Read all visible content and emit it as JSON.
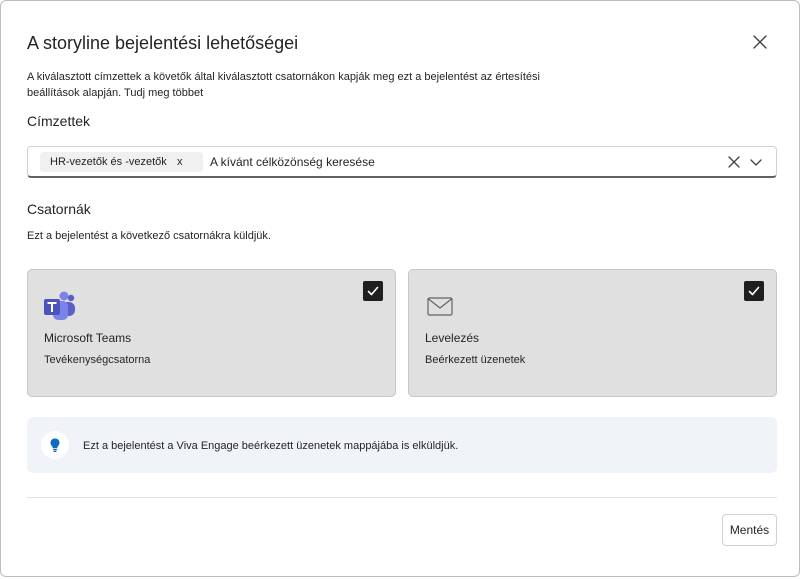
{
  "dialog": {
    "title": "A storyline bejelentési lehetőségei",
    "description": "A kiválasztott címzettek a követők által kiválasztott csatornákon kapják meg ezt a bejelentést az értesítési beállítások alapján.",
    "more_link": "Tudj meg többet"
  },
  "recipients": {
    "label": "Címzettek",
    "chip_label": "HR-vezetők és -vezetők",
    "chip_remove": "x",
    "search_placeholder": "A kívánt célközönség keresése",
    "icons": {
      "clear": "close-icon",
      "dropdown": "chevron-down-icon"
    }
  },
  "channels": {
    "label": "Csatornák",
    "description": "Ezt a bejelentést a következő csatornákra küldjük.",
    "cards": [
      {
        "title": "Microsoft Teams",
        "subtitle": "Tevékenységcsatorna",
        "icon": "teams-icon",
        "checked": true
      },
      {
        "title": "Levelezés",
        "subtitle": "Beérkezett üzenetek",
        "icon": "mail-icon",
        "checked": true
      }
    ]
  },
  "info": {
    "text": "Ezt a bejelentést a Viva Engage beérkezett üzenetek mappájába is elküldjük.",
    "icon": "lightbulb-icon"
  },
  "footer": {
    "save_label": "Mentés"
  },
  "colors": {
    "card_background": "#e0e0e0",
    "checkbox": "#1f1f1f",
    "info_background": "#f0f4f9",
    "info_icon": "#0f6cbd",
    "teams_purple": "#5b5fc7"
  }
}
